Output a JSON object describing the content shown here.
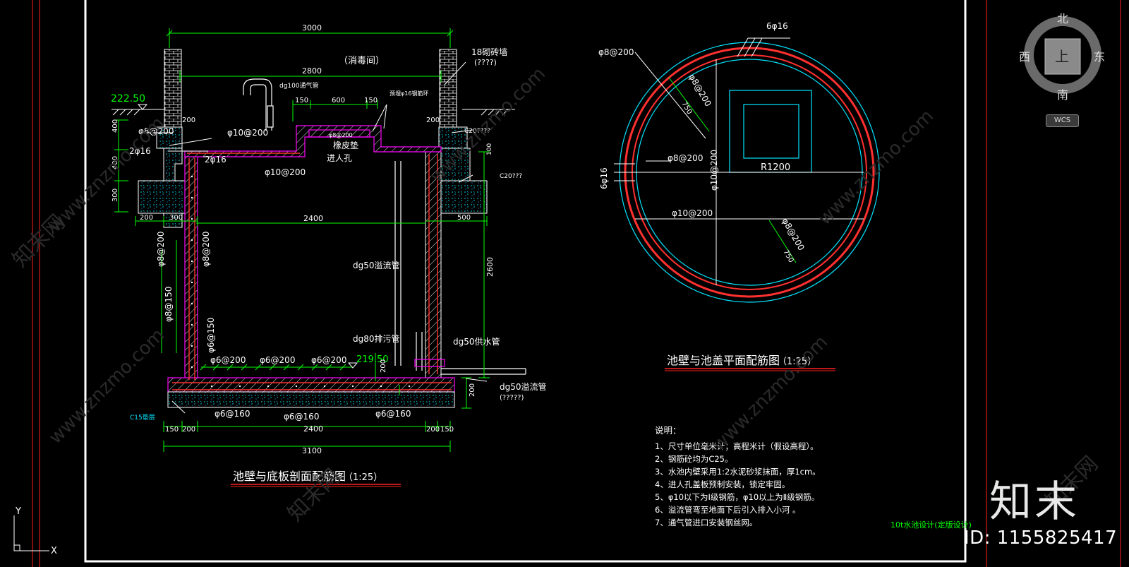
{
  "colors": {
    "background": "#000000",
    "frame": "#ffffff",
    "dimension": "#00ff00",
    "rebar": "#ff3030",
    "concrete": "#00e5ff",
    "brick": "#ffffff",
    "pipe": "#ffffff",
    "wall_outline": "#ff00ff",
    "title_underline": "#ff2020",
    "ground": "#ffffff"
  },
  "section": {
    "title": "池壁与底板剖面配筋图",
    "scale": "（1:25）",
    "room_label": "（消毒间）",
    "brick_wall_label": "18砌砖墙",
    "brick_wall_sub": "(????)",
    "elev_top": "222.50",
    "elev_bottom": "219.50",
    "dims": {
      "top_total": "3000",
      "top_inner": "2800",
      "manhole_left": "150",
      "manhole_mid": "600",
      "manhole_right": "150",
      "left_200": "200",
      "right_200": "200",
      "v_400a": "400",
      "v_400b": "400",
      "v_300": "300",
      "bot_200": "200",
      "bot_300": "300",
      "span_2400": "2400",
      "right_500": "500",
      "v_100": "100",
      "v_2600": "2600",
      "v_200_slab": "200",
      "v_200_pipe": "200",
      "base_150a": "150",
      "base_200a": "200",
      "base_2400": "2400",
      "base_200b": "200",
      "base_150b": "150",
      "base_total": "3100"
    },
    "labels": {
      "vent_pipe": "dg100通气管",
      "rebar_ring": "预埋φ16钢筋环",
      "phi8_200_top": "φ8@200",
      "phi10_200_top": "φ10@200",
      "phi10_200_mid": "φ10@200",
      "two_phi16_a": "2φ16",
      "two_phi16_b": "2φ16",
      "rubber_pad": "橡皮垫",
      "manhole": "进人孔",
      "phi8_200_cover": "φ8@200",
      "c20_a": "C20????",
      "c20_b": "C20???",
      "overflow_vertical": "dg50溢流管",
      "drain_pipe": "dg80排污管",
      "supply_pipe": "dg50供水管",
      "overflow_out": "dg50溢流管",
      "overflow_out_sub": "(?????)",
      "wall_phi8_a": "φ8@200",
      "wall_phi8_b": "φ8@200",
      "wall_phi8_150": "φ8@150",
      "wall_phi6_150": "φ6@150",
      "slab_phi6_a": "φ6@200",
      "slab_phi6_b": "φ6@200",
      "slab_phi6_c": "φ6@200",
      "base_phi6_a": "φ6@160",
      "base_phi6_b": "φ6@160",
      "base_phi6_c": "φ6@160",
      "cushion": "C15垫层"
    }
  },
  "plan": {
    "title": "池壁与池盖平面配筋图",
    "scale": "（1:25）",
    "labels": {
      "top_phi16": "6φ16",
      "left_phi8": "φ8@200",
      "diag_phi8": "φ8@200",
      "diag_750": "750",
      "mid_phi8": "φ8@200",
      "left_phi16": "6φ16",
      "vert_phi10": "φ10@200",
      "radius": "R1200",
      "horiz_phi10": "φ10@200",
      "diag2_phi8": "φ8@200",
      "diag2_750": "750"
    }
  },
  "notes": {
    "heading": "说明：",
    "items": [
      "1、尺寸单位毫米计；高程米计（假设高程）。",
      "2、钢筋砼均为C25。",
      "3、水池内壁采用1:2水泥砂浆抹面，厚1cm。",
      "4、进人孔盖板预制安装，锁定牢固。",
      "5、φ10以下为Ⅰ级钢筋，φ10以上为Ⅱ级钢筋。",
      "6、溢流管弯至地面下后引入排入小河 。",
      "7、通气管进口安装钢丝网。"
    ],
    "stamp": "10t水池设计(定版设计)"
  },
  "viewcube": {
    "north": "北",
    "south": "南",
    "east": "东",
    "west": "西",
    "top": "上",
    "wcs": "WCS"
  },
  "ucs": {
    "x": "X",
    "y": "Y"
  },
  "watermark": {
    "site": "www.znzmo.com",
    "brand": "知末网",
    "logo": "知末",
    "id": "ID: 1155825417"
  }
}
